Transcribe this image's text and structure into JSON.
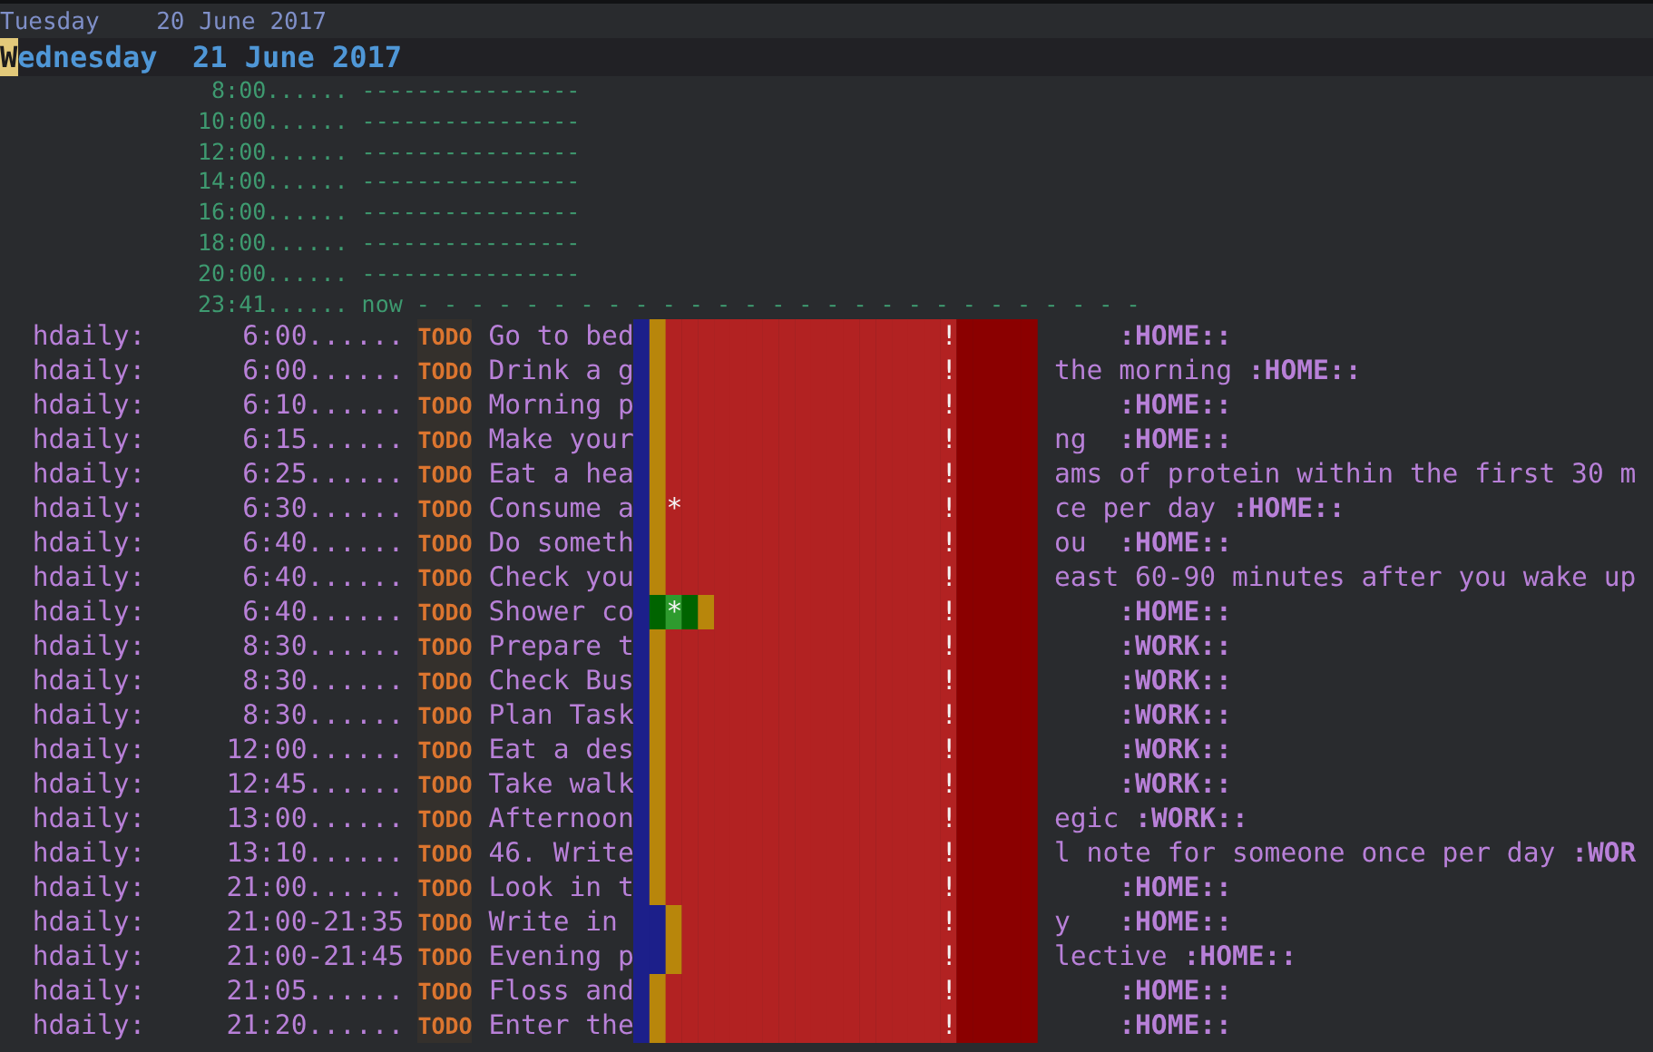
{
  "days": [
    {
      "heading": "Tuesday    20 June 2017",
      "today": false,
      "cursor": false
    },
    {
      "heading": "Wednesday  21 June 2017",
      "today": true,
      "cursor": true
    }
  ],
  "time_grid": [
    {
      "time": "8:00......",
      "line": "----------------"
    },
    {
      "time": "10:00......",
      "line": "----------------"
    },
    {
      "time": "12:00......",
      "line": "----------------"
    },
    {
      "time": "14:00......",
      "line": "----------------"
    },
    {
      "time": "16:00......",
      "line": "----------------"
    },
    {
      "time": "18:00......",
      "line": "----------------"
    },
    {
      "time": "20:00......",
      "line": "----------------"
    },
    {
      "time": "23:41......",
      "line": "now - - - - - - - - - - - - - - - - - - - - - - - - - - -"
    }
  ],
  "habits": [
    {
      "category": "hdaily:",
      "time": "6:00......",
      "keyword": "TODO",
      "title_start": "Go to bed",
      "tag": ":HOME::",
      "graph": [
        {
          "kind": "clear"
        },
        {
          "kind": "alert"
        },
        {
          "kind": "overdue"
        },
        {
          "kind": "overdue"
        },
        {
          "kind": "overdue"
        },
        {
          "kind": "overdue"
        },
        {
          "kind": "overdue"
        },
        {
          "kind": "overdue"
        },
        {
          "kind": "overdue"
        },
        {
          "kind": "overdue"
        },
        {
          "kind": "overdue"
        },
        {
          "kind": "overdue"
        },
        {
          "kind": "overdue"
        },
        {
          "kind": "overdue"
        },
        {
          "kind": "overdue"
        },
        {
          "kind": "overdue"
        },
        {
          "kind": "overdue"
        },
        {
          "kind": "overdue"
        },
        {
          "kind": "overdue"
        },
        {
          "kind": "overdue",
          "mark": "!"
        },
        {
          "kind": "future"
        },
        {
          "kind": "future"
        },
        {
          "kind": "future"
        },
        {
          "kind": "future"
        },
        {
          "kind": "future"
        }
      ]
    },
    {
      "category": "hdaily:",
      "time": "6:00......",
      "keyword": "TODO",
      "title_start": "Drink a g",
      "title_end": "the morning ",
      "tag": ":HOME::",
      "graph": [
        {
          "kind": "clear"
        },
        {
          "kind": "alert"
        },
        {
          "kind": "overdue"
        },
        {
          "kind": "overdue"
        },
        {
          "kind": "overdue"
        },
        {
          "kind": "overdue"
        },
        {
          "kind": "overdue"
        },
        {
          "kind": "overdue"
        },
        {
          "kind": "overdue"
        },
        {
          "kind": "overdue"
        },
        {
          "kind": "overdue"
        },
        {
          "kind": "overdue"
        },
        {
          "kind": "overdue"
        },
        {
          "kind": "overdue"
        },
        {
          "kind": "overdue"
        },
        {
          "kind": "overdue"
        },
        {
          "kind": "overdue"
        },
        {
          "kind": "overdue"
        },
        {
          "kind": "overdue"
        },
        {
          "kind": "overdue",
          "mark": "!"
        },
        {
          "kind": "future"
        },
        {
          "kind": "future"
        },
        {
          "kind": "future"
        },
        {
          "kind": "future"
        },
        {
          "kind": "future"
        }
      ]
    },
    {
      "category": "hdaily:",
      "time": "6:10......",
      "keyword": "TODO",
      "title_start": "Morning p",
      "tag": ":HOME::",
      "graph": [
        {
          "kind": "clear"
        },
        {
          "kind": "alert"
        },
        {
          "kind": "overdue"
        },
        {
          "kind": "overdue"
        },
        {
          "kind": "overdue"
        },
        {
          "kind": "overdue"
        },
        {
          "kind": "overdue"
        },
        {
          "kind": "overdue"
        },
        {
          "kind": "overdue"
        },
        {
          "kind": "overdue"
        },
        {
          "kind": "overdue"
        },
        {
          "kind": "overdue"
        },
        {
          "kind": "overdue"
        },
        {
          "kind": "overdue"
        },
        {
          "kind": "overdue"
        },
        {
          "kind": "overdue"
        },
        {
          "kind": "overdue"
        },
        {
          "kind": "overdue"
        },
        {
          "kind": "overdue"
        },
        {
          "kind": "overdue",
          "mark": "!"
        },
        {
          "kind": "future"
        },
        {
          "kind": "future"
        },
        {
          "kind": "future"
        },
        {
          "kind": "future"
        },
        {
          "kind": "future"
        }
      ]
    },
    {
      "category": "hdaily:",
      "time": "6:15......",
      "keyword": "TODO",
      "title_start": "Make your",
      "title_end": "ng  ",
      "tag": ":HOME::",
      "graph": [
        {
          "kind": "clear"
        },
        {
          "kind": "alert"
        },
        {
          "kind": "overdue"
        },
        {
          "kind": "overdue"
        },
        {
          "kind": "overdue"
        },
        {
          "kind": "overdue"
        },
        {
          "kind": "overdue"
        },
        {
          "kind": "overdue"
        },
        {
          "kind": "overdue"
        },
        {
          "kind": "overdue"
        },
        {
          "kind": "overdue"
        },
        {
          "kind": "overdue"
        },
        {
          "kind": "overdue"
        },
        {
          "kind": "overdue"
        },
        {
          "kind": "overdue"
        },
        {
          "kind": "overdue"
        },
        {
          "kind": "overdue"
        },
        {
          "kind": "overdue"
        },
        {
          "kind": "overdue"
        },
        {
          "kind": "overdue",
          "mark": "!"
        },
        {
          "kind": "future"
        },
        {
          "kind": "future"
        },
        {
          "kind": "future"
        },
        {
          "kind": "future"
        },
        {
          "kind": "future"
        }
      ]
    },
    {
      "category": "hdaily:",
      "time": "6:25......",
      "keyword": "TODO",
      "title_start": "Eat a hea",
      "title_end": "ams of protein within the first 30 m",
      "graph": [
        {
          "kind": "clear"
        },
        {
          "kind": "alert"
        },
        {
          "kind": "overdue"
        },
        {
          "kind": "overdue"
        },
        {
          "kind": "overdue"
        },
        {
          "kind": "overdue"
        },
        {
          "kind": "overdue"
        },
        {
          "kind": "overdue"
        },
        {
          "kind": "overdue"
        },
        {
          "kind": "overdue"
        },
        {
          "kind": "overdue"
        },
        {
          "kind": "overdue"
        },
        {
          "kind": "overdue"
        },
        {
          "kind": "overdue"
        },
        {
          "kind": "overdue"
        },
        {
          "kind": "overdue"
        },
        {
          "kind": "overdue"
        },
        {
          "kind": "overdue"
        },
        {
          "kind": "overdue"
        },
        {
          "kind": "overdue",
          "mark": "!"
        },
        {
          "kind": "future"
        },
        {
          "kind": "future"
        },
        {
          "kind": "future"
        },
        {
          "kind": "future"
        },
        {
          "kind": "future"
        }
      ]
    },
    {
      "category": "hdaily:",
      "time": "6:30......",
      "keyword": "TODO",
      "title_start": "Consume a",
      "title_end": "ce per day ",
      "tag": ":HOME::",
      "graph": [
        {
          "kind": "clear"
        },
        {
          "kind": "alert"
        },
        {
          "kind": "overdue",
          "mark": "*"
        },
        {
          "kind": "overdue"
        },
        {
          "kind": "overdue"
        },
        {
          "kind": "overdue"
        },
        {
          "kind": "overdue"
        },
        {
          "kind": "overdue"
        },
        {
          "kind": "overdue"
        },
        {
          "kind": "overdue"
        },
        {
          "kind": "overdue"
        },
        {
          "kind": "overdue"
        },
        {
          "kind": "overdue"
        },
        {
          "kind": "overdue"
        },
        {
          "kind": "overdue"
        },
        {
          "kind": "overdue"
        },
        {
          "kind": "overdue"
        },
        {
          "kind": "overdue"
        },
        {
          "kind": "overdue"
        },
        {
          "kind": "overdue",
          "mark": "!"
        },
        {
          "kind": "future"
        },
        {
          "kind": "future"
        },
        {
          "kind": "future"
        },
        {
          "kind": "future"
        },
        {
          "kind": "future"
        }
      ]
    },
    {
      "category": "hdaily:",
      "time": "6:40......",
      "keyword": "TODO",
      "title_start": "Do someth",
      "title_end": "ou  ",
      "tag": ":HOME::",
      "graph": [
        {
          "kind": "clear"
        },
        {
          "kind": "alert"
        },
        {
          "kind": "overdue"
        },
        {
          "kind": "overdue"
        },
        {
          "kind": "overdue"
        },
        {
          "kind": "overdue"
        },
        {
          "kind": "overdue"
        },
        {
          "kind": "overdue"
        },
        {
          "kind": "overdue"
        },
        {
          "kind": "overdue"
        },
        {
          "kind": "overdue"
        },
        {
          "kind": "overdue"
        },
        {
          "kind": "overdue"
        },
        {
          "kind": "overdue"
        },
        {
          "kind": "overdue"
        },
        {
          "kind": "overdue"
        },
        {
          "kind": "overdue"
        },
        {
          "kind": "overdue"
        },
        {
          "kind": "overdue"
        },
        {
          "kind": "overdue",
          "mark": "!"
        },
        {
          "kind": "future"
        },
        {
          "kind": "future"
        },
        {
          "kind": "future"
        },
        {
          "kind": "future"
        },
        {
          "kind": "future"
        }
      ]
    },
    {
      "category": "hdaily:",
      "time": "6:40......",
      "keyword": "TODO",
      "title_start": "Check you",
      "title_end": "east 60-90 minutes after you wake up",
      "graph": [
        {
          "kind": "clear"
        },
        {
          "kind": "alert"
        },
        {
          "kind": "overdue"
        },
        {
          "kind": "overdue"
        },
        {
          "kind": "overdue"
        },
        {
          "kind": "overdue"
        },
        {
          "kind": "overdue"
        },
        {
          "kind": "overdue"
        },
        {
          "kind": "overdue"
        },
        {
          "kind": "overdue"
        },
        {
          "kind": "overdue"
        },
        {
          "kind": "overdue"
        },
        {
          "kind": "overdue"
        },
        {
          "kind": "overdue"
        },
        {
          "kind": "overdue"
        },
        {
          "kind": "overdue"
        },
        {
          "kind": "overdue"
        },
        {
          "kind": "overdue"
        },
        {
          "kind": "overdue"
        },
        {
          "kind": "overdue",
          "mark": "!"
        },
        {
          "kind": "future"
        },
        {
          "kind": "future"
        },
        {
          "kind": "future"
        },
        {
          "kind": "future"
        },
        {
          "kind": "future"
        }
      ]
    },
    {
      "category": "hdaily:",
      "time": "6:40......",
      "keyword": "TODO",
      "title_start": "Shower co",
      "tag": ":HOME::",
      "graph": [
        {
          "kind": "clear"
        },
        {
          "kind": "ready"
        },
        {
          "kind": "done",
          "mark": "*"
        },
        {
          "kind": "ready"
        },
        {
          "kind": "alert"
        },
        {
          "kind": "overdue"
        },
        {
          "kind": "overdue"
        },
        {
          "kind": "overdue"
        },
        {
          "kind": "overdue"
        },
        {
          "kind": "overdue"
        },
        {
          "kind": "overdue"
        },
        {
          "kind": "overdue"
        },
        {
          "kind": "overdue"
        },
        {
          "kind": "overdue"
        },
        {
          "kind": "overdue"
        },
        {
          "kind": "overdue"
        },
        {
          "kind": "overdue"
        },
        {
          "kind": "overdue"
        },
        {
          "kind": "overdue"
        },
        {
          "kind": "overdue",
          "mark": "!"
        },
        {
          "kind": "future"
        },
        {
          "kind": "future"
        },
        {
          "kind": "future"
        },
        {
          "kind": "future"
        },
        {
          "kind": "future"
        }
      ]
    },
    {
      "category": "hdaily:",
      "time": "8:30......",
      "keyword": "TODO",
      "title_start": "Prepare t",
      "tag": ":WORK::",
      "graph": [
        {
          "kind": "clear"
        },
        {
          "kind": "alert"
        },
        {
          "kind": "overdue"
        },
        {
          "kind": "overdue"
        },
        {
          "kind": "overdue"
        },
        {
          "kind": "overdue"
        },
        {
          "kind": "overdue"
        },
        {
          "kind": "overdue"
        },
        {
          "kind": "overdue"
        },
        {
          "kind": "overdue"
        },
        {
          "kind": "overdue"
        },
        {
          "kind": "overdue"
        },
        {
          "kind": "overdue"
        },
        {
          "kind": "overdue"
        },
        {
          "kind": "overdue"
        },
        {
          "kind": "overdue"
        },
        {
          "kind": "overdue"
        },
        {
          "kind": "overdue"
        },
        {
          "kind": "overdue"
        },
        {
          "kind": "overdue",
          "mark": "!"
        },
        {
          "kind": "future"
        },
        {
          "kind": "future"
        },
        {
          "kind": "future"
        },
        {
          "kind": "future"
        },
        {
          "kind": "future"
        }
      ]
    },
    {
      "category": "hdaily:",
      "time": "8:30......",
      "keyword": "TODO",
      "title_start": "Check Bus",
      "tag": ":WORK::",
      "graph": [
        {
          "kind": "clear"
        },
        {
          "kind": "alert"
        },
        {
          "kind": "overdue"
        },
        {
          "kind": "overdue"
        },
        {
          "kind": "overdue"
        },
        {
          "kind": "overdue"
        },
        {
          "kind": "overdue"
        },
        {
          "kind": "overdue"
        },
        {
          "kind": "overdue"
        },
        {
          "kind": "overdue"
        },
        {
          "kind": "overdue"
        },
        {
          "kind": "overdue"
        },
        {
          "kind": "overdue"
        },
        {
          "kind": "overdue"
        },
        {
          "kind": "overdue"
        },
        {
          "kind": "overdue"
        },
        {
          "kind": "overdue"
        },
        {
          "kind": "overdue"
        },
        {
          "kind": "overdue"
        },
        {
          "kind": "overdue",
          "mark": "!"
        },
        {
          "kind": "future"
        },
        {
          "kind": "future"
        },
        {
          "kind": "future"
        },
        {
          "kind": "future"
        },
        {
          "kind": "future"
        }
      ]
    },
    {
      "category": "hdaily:",
      "time": "8:30......",
      "keyword": "TODO",
      "title_start": "Plan Task",
      "tag": ":WORK::",
      "graph": [
        {
          "kind": "clear"
        },
        {
          "kind": "alert"
        },
        {
          "kind": "overdue"
        },
        {
          "kind": "overdue"
        },
        {
          "kind": "overdue"
        },
        {
          "kind": "overdue"
        },
        {
          "kind": "overdue"
        },
        {
          "kind": "overdue"
        },
        {
          "kind": "overdue"
        },
        {
          "kind": "overdue"
        },
        {
          "kind": "overdue"
        },
        {
          "kind": "overdue"
        },
        {
          "kind": "overdue"
        },
        {
          "kind": "overdue"
        },
        {
          "kind": "overdue"
        },
        {
          "kind": "overdue"
        },
        {
          "kind": "overdue"
        },
        {
          "kind": "overdue"
        },
        {
          "kind": "overdue"
        },
        {
          "kind": "overdue",
          "mark": "!"
        },
        {
          "kind": "future"
        },
        {
          "kind": "future"
        },
        {
          "kind": "future"
        },
        {
          "kind": "future"
        },
        {
          "kind": "future"
        }
      ]
    },
    {
      "category": "hdaily:",
      "time": "12:00......",
      "keyword": "TODO",
      "title_start": "Eat a des",
      "tag": ":WORK::",
      "graph": [
        {
          "kind": "clear"
        },
        {
          "kind": "alert"
        },
        {
          "kind": "overdue"
        },
        {
          "kind": "overdue"
        },
        {
          "kind": "overdue"
        },
        {
          "kind": "overdue"
        },
        {
          "kind": "overdue"
        },
        {
          "kind": "overdue"
        },
        {
          "kind": "overdue"
        },
        {
          "kind": "overdue"
        },
        {
          "kind": "overdue"
        },
        {
          "kind": "overdue"
        },
        {
          "kind": "overdue"
        },
        {
          "kind": "overdue"
        },
        {
          "kind": "overdue"
        },
        {
          "kind": "overdue"
        },
        {
          "kind": "overdue"
        },
        {
          "kind": "overdue"
        },
        {
          "kind": "overdue"
        },
        {
          "kind": "overdue",
          "mark": "!"
        },
        {
          "kind": "future"
        },
        {
          "kind": "future"
        },
        {
          "kind": "future"
        },
        {
          "kind": "future"
        },
        {
          "kind": "future"
        }
      ]
    },
    {
      "category": "hdaily:",
      "time": "12:45......",
      "keyword": "TODO",
      "title_start": "Take walk",
      "tag": ":WORK::",
      "graph": [
        {
          "kind": "clear"
        },
        {
          "kind": "alert"
        },
        {
          "kind": "overdue"
        },
        {
          "kind": "overdue"
        },
        {
          "kind": "overdue"
        },
        {
          "kind": "overdue"
        },
        {
          "kind": "overdue"
        },
        {
          "kind": "overdue"
        },
        {
          "kind": "overdue"
        },
        {
          "kind": "overdue"
        },
        {
          "kind": "overdue"
        },
        {
          "kind": "overdue"
        },
        {
          "kind": "overdue"
        },
        {
          "kind": "overdue"
        },
        {
          "kind": "overdue"
        },
        {
          "kind": "overdue"
        },
        {
          "kind": "overdue"
        },
        {
          "kind": "overdue"
        },
        {
          "kind": "overdue"
        },
        {
          "kind": "overdue",
          "mark": "!"
        },
        {
          "kind": "future"
        },
        {
          "kind": "future"
        },
        {
          "kind": "future"
        },
        {
          "kind": "future"
        },
        {
          "kind": "future"
        }
      ]
    },
    {
      "category": "hdaily:",
      "time": "13:00......",
      "keyword": "TODO",
      "title_start": "Afternoon",
      "title_end": "egic ",
      "tag": ":WORK::",
      "graph": [
        {
          "kind": "clear"
        },
        {
          "kind": "alert"
        },
        {
          "kind": "overdue"
        },
        {
          "kind": "overdue"
        },
        {
          "kind": "overdue"
        },
        {
          "kind": "overdue"
        },
        {
          "kind": "overdue"
        },
        {
          "kind": "overdue"
        },
        {
          "kind": "overdue"
        },
        {
          "kind": "overdue"
        },
        {
          "kind": "overdue"
        },
        {
          "kind": "overdue"
        },
        {
          "kind": "overdue"
        },
        {
          "kind": "overdue"
        },
        {
          "kind": "overdue"
        },
        {
          "kind": "overdue"
        },
        {
          "kind": "overdue"
        },
        {
          "kind": "overdue"
        },
        {
          "kind": "overdue"
        },
        {
          "kind": "overdue",
          "mark": "!"
        },
        {
          "kind": "future"
        },
        {
          "kind": "future"
        },
        {
          "kind": "future"
        },
        {
          "kind": "future"
        },
        {
          "kind": "future"
        }
      ]
    },
    {
      "category": "hdaily:",
      "time": "13:10......",
      "keyword": "TODO",
      "title_start": "46. Write",
      "title_end": "l note for someone once per day ",
      "tag": ":WOR",
      "graph": [
        {
          "kind": "clear"
        },
        {
          "kind": "alert"
        },
        {
          "kind": "overdue"
        },
        {
          "kind": "overdue"
        },
        {
          "kind": "overdue"
        },
        {
          "kind": "overdue"
        },
        {
          "kind": "overdue"
        },
        {
          "kind": "overdue"
        },
        {
          "kind": "overdue"
        },
        {
          "kind": "overdue"
        },
        {
          "kind": "overdue"
        },
        {
          "kind": "overdue"
        },
        {
          "kind": "overdue"
        },
        {
          "kind": "overdue"
        },
        {
          "kind": "overdue"
        },
        {
          "kind": "overdue"
        },
        {
          "kind": "overdue"
        },
        {
          "kind": "overdue"
        },
        {
          "kind": "overdue"
        },
        {
          "kind": "overdue",
          "mark": "!"
        },
        {
          "kind": "future"
        },
        {
          "kind": "future"
        },
        {
          "kind": "future"
        },
        {
          "kind": "future"
        },
        {
          "kind": "future"
        }
      ]
    },
    {
      "category": "hdaily:",
      "time": "21:00......",
      "keyword": "TODO",
      "title_start": "Look in t",
      "tag": ":HOME::",
      "graph": [
        {
          "kind": "clear"
        },
        {
          "kind": "alert"
        },
        {
          "kind": "overdue"
        },
        {
          "kind": "overdue"
        },
        {
          "kind": "overdue"
        },
        {
          "kind": "overdue"
        },
        {
          "kind": "overdue"
        },
        {
          "kind": "overdue"
        },
        {
          "kind": "overdue"
        },
        {
          "kind": "overdue"
        },
        {
          "kind": "overdue"
        },
        {
          "kind": "overdue"
        },
        {
          "kind": "overdue"
        },
        {
          "kind": "overdue"
        },
        {
          "kind": "overdue"
        },
        {
          "kind": "overdue"
        },
        {
          "kind": "overdue"
        },
        {
          "kind": "overdue"
        },
        {
          "kind": "overdue"
        },
        {
          "kind": "overdue",
          "mark": "!"
        },
        {
          "kind": "future"
        },
        {
          "kind": "future"
        },
        {
          "kind": "future"
        },
        {
          "kind": "future"
        },
        {
          "kind": "future"
        }
      ]
    },
    {
      "category": "hdaily:",
      "time": "21:00-21:35",
      "keyword": "TODO",
      "title_start": "Write in",
      "title_end": "y   ",
      "tag": ":HOME::",
      "graph": [
        {
          "kind": "clear"
        },
        {
          "kind": "clear"
        },
        {
          "kind": "alert"
        },
        {
          "kind": "overdue"
        },
        {
          "kind": "overdue"
        },
        {
          "kind": "overdue"
        },
        {
          "kind": "overdue"
        },
        {
          "kind": "overdue"
        },
        {
          "kind": "overdue"
        },
        {
          "kind": "overdue"
        },
        {
          "kind": "overdue"
        },
        {
          "kind": "overdue"
        },
        {
          "kind": "overdue"
        },
        {
          "kind": "overdue"
        },
        {
          "kind": "overdue"
        },
        {
          "kind": "overdue"
        },
        {
          "kind": "overdue"
        },
        {
          "kind": "overdue"
        },
        {
          "kind": "overdue"
        },
        {
          "kind": "overdue",
          "mark": "!"
        },
        {
          "kind": "future"
        },
        {
          "kind": "future"
        },
        {
          "kind": "future"
        },
        {
          "kind": "future"
        },
        {
          "kind": "future"
        }
      ]
    },
    {
      "category": "hdaily:",
      "time": "21:00-21:45",
      "keyword": "TODO",
      "title_start": "Evening p",
      "title_end": "lective ",
      "tag": ":HOME::",
      "graph": [
        {
          "kind": "clear"
        },
        {
          "kind": "clear"
        },
        {
          "kind": "alert"
        },
        {
          "kind": "overdue"
        },
        {
          "kind": "overdue"
        },
        {
          "kind": "overdue"
        },
        {
          "kind": "overdue"
        },
        {
          "kind": "overdue"
        },
        {
          "kind": "overdue"
        },
        {
          "kind": "overdue"
        },
        {
          "kind": "overdue"
        },
        {
          "kind": "overdue"
        },
        {
          "kind": "overdue"
        },
        {
          "kind": "overdue"
        },
        {
          "kind": "overdue"
        },
        {
          "kind": "overdue"
        },
        {
          "kind": "overdue"
        },
        {
          "kind": "overdue"
        },
        {
          "kind": "overdue"
        },
        {
          "kind": "overdue",
          "mark": "!"
        },
        {
          "kind": "future"
        },
        {
          "kind": "future"
        },
        {
          "kind": "future"
        },
        {
          "kind": "future"
        },
        {
          "kind": "future"
        }
      ]
    },
    {
      "category": "hdaily:",
      "time": "21:05......",
      "keyword": "TODO",
      "title_start": "Floss and",
      "tag": ":HOME::",
      "graph": [
        {
          "kind": "clear"
        },
        {
          "kind": "alert"
        },
        {
          "kind": "overdue"
        },
        {
          "kind": "overdue"
        },
        {
          "kind": "overdue"
        },
        {
          "kind": "overdue"
        },
        {
          "kind": "overdue"
        },
        {
          "kind": "overdue"
        },
        {
          "kind": "overdue"
        },
        {
          "kind": "overdue"
        },
        {
          "kind": "overdue"
        },
        {
          "kind": "overdue"
        },
        {
          "kind": "overdue"
        },
        {
          "kind": "overdue"
        },
        {
          "kind": "overdue"
        },
        {
          "kind": "overdue"
        },
        {
          "kind": "overdue"
        },
        {
          "kind": "overdue"
        },
        {
          "kind": "overdue"
        },
        {
          "kind": "overdue",
          "mark": "!"
        },
        {
          "kind": "future"
        },
        {
          "kind": "future"
        },
        {
          "kind": "future"
        },
        {
          "kind": "future"
        },
        {
          "kind": "future"
        }
      ]
    },
    {
      "category": "hdaily:",
      "time": "21:20......",
      "keyword": "TODO",
      "title_start": "Enter the",
      "tag": ":HOME::",
      "graph": [
        {
          "kind": "clear"
        },
        {
          "kind": "alert"
        },
        {
          "kind": "overdue"
        },
        {
          "kind": "overdue"
        },
        {
          "kind": "overdue"
        },
        {
          "kind": "overdue"
        },
        {
          "kind": "overdue"
        },
        {
          "kind": "overdue"
        },
        {
          "kind": "overdue"
        },
        {
          "kind": "overdue"
        },
        {
          "kind": "overdue"
        },
        {
          "kind": "overdue"
        },
        {
          "kind": "overdue"
        },
        {
          "kind": "overdue"
        },
        {
          "kind": "overdue"
        },
        {
          "kind": "overdue"
        },
        {
          "kind": "overdue"
        },
        {
          "kind": "overdue"
        },
        {
          "kind": "overdue"
        },
        {
          "kind": "overdue",
          "mark": "!"
        },
        {
          "kind": "future"
        },
        {
          "kind": "future"
        },
        {
          "kind": "future"
        },
        {
          "kind": "future"
        },
        {
          "kind": "future"
        }
      ]
    }
  ]
}
